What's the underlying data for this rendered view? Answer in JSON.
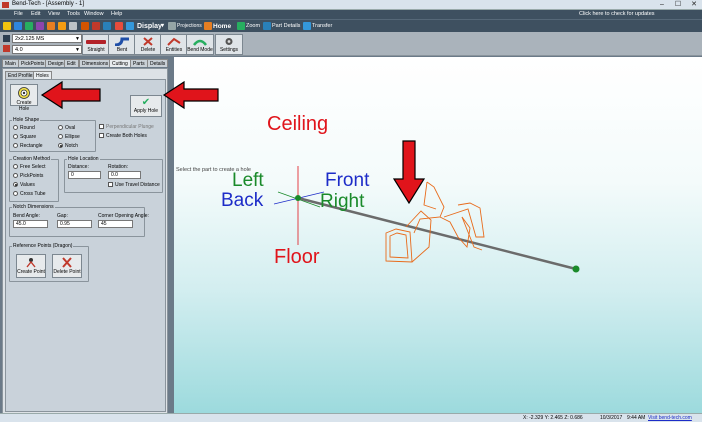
{
  "window": {
    "title": "Bend-Tech - [Assembly - 1]",
    "update_notice": "Click here to check for updates",
    "min": "–",
    "max": "☐",
    "close": "✕"
  },
  "menu": [
    "File",
    "Edit",
    "View",
    "Tools",
    "Window",
    "Help"
  ],
  "toolbar": {
    "display": "Display",
    "projections": "Projections",
    "home": "Home",
    "zoom": "Zoom",
    "part_details": "Part Details",
    "transfer": "Transfer"
  },
  "tube_combo": "2x2.125 MS",
  "radius_combo": "4.0",
  "ribbon": {
    "straight": "Straight",
    "bent": "Bent",
    "delete": "Delete",
    "entities": "Entities",
    "bend_mode": "Bend Mode",
    "settings": "Settings"
  },
  "tabs": [
    "Main",
    "PickPoints",
    "Design",
    "Edit",
    "Dimensions",
    "Cutting",
    "Parts",
    "Details"
  ],
  "subtabs": [
    "End Profiles",
    "Holes"
  ],
  "buttons": {
    "create_hole": "Create Hole",
    "apply_hole": "Apply Hole",
    "create_point": "Create Point",
    "delete_point": "Delete Point"
  },
  "hole_shape": {
    "title": "Hole Shape",
    "options": [
      "Round",
      "Oval",
      "Square",
      "Ellipse",
      "Rectangle",
      "Notch"
    ],
    "selected": "Notch",
    "perpendicular": "Perpendicular Plunge",
    "create_both": "Create Both Holes"
  },
  "creation": {
    "title": "Creation Method",
    "options": [
      "Free Select",
      "PickPoints",
      "Values",
      "Cross Tube"
    ],
    "selected": "Values"
  },
  "hole_location": {
    "title": "Hole Location",
    "distance_label": "Distance:",
    "distance": "0",
    "rotation_label": "Rotation:",
    "rotation": "0.0",
    "use_travel": "Use Travel Distance"
  },
  "notch_dims": {
    "title": "Notch Dimensions",
    "bend_angle_label": "Bend Angle:",
    "bend_angle": "45.0",
    "gap_label": "Gap:",
    "gap": "0.95",
    "corner_label": "Corner Opening Angle:",
    "corner": "45"
  },
  "ref_points": {
    "title": "Reference Points (Dragon)"
  },
  "viewport": {
    "ceiling": "Ceiling",
    "floor": "Floor",
    "left": "Left",
    "back": "Back",
    "front": "Front",
    "right": "Right",
    "hint": "Select the part to create a hole"
  },
  "status": {
    "coords": "X: -2.329  Y: 2.465  Z: 0.686",
    "date": "10/3/2017",
    "time": "9:44 AM",
    "site": "Visit bend-tech.com"
  },
  "colors": {
    "accent_red": "#e0141b",
    "label_red": "#e0141b",
    "label_blue": "#1d2cc8",
    "label_green": "#1a8a2a"
  }
}
